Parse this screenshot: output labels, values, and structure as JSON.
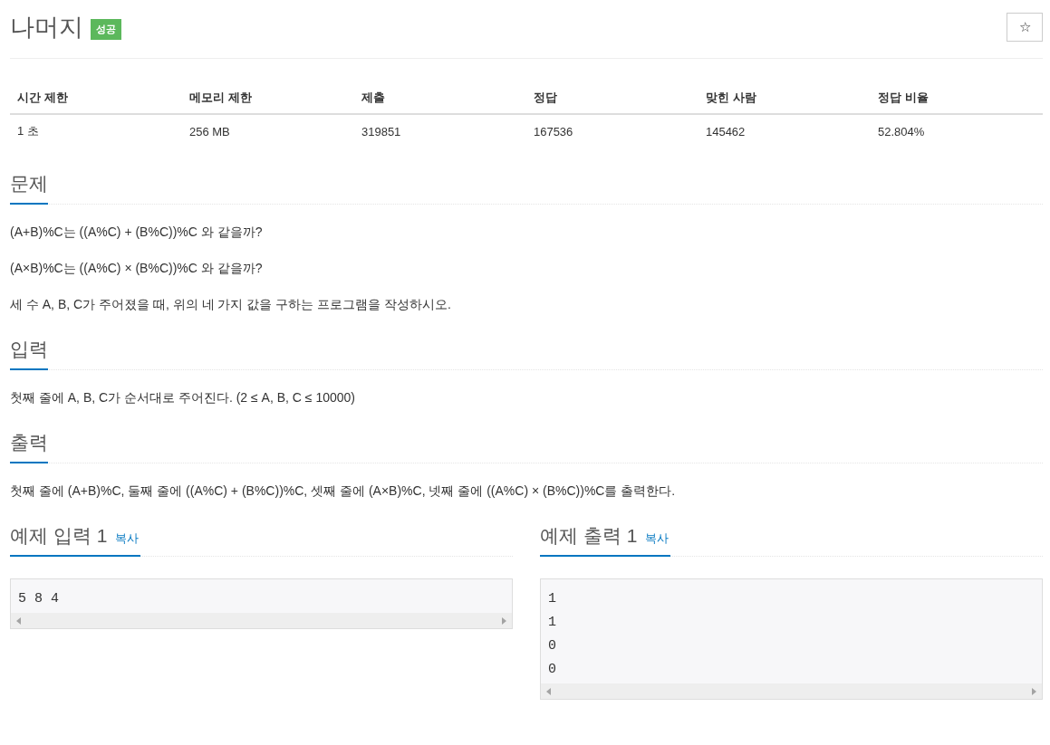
{
  "title": "나머지",
  "badge": "성공",
  "star_button": "☆",
  "info_table": {
    "columns": [
      "시간 제한",
      "메모리 제한",
      "제출",
      "정답",
      "맞힌 사람",
      "정답 비율"
    ],
    "rows": [
      [
        "1 초",
        "256 MB",
        "319851",
        "167536",
        "145462",
        "52.804%"
      ]
    ]
  },
  "sections": [
    {
      "heading": "문제",
      "paragraphs": [
        "(A+B)%C는 ((A%C) + (B%C))%C 와 같을까?",
        "(A×B)%C는 ((A%C) × (B%C))%C 와 같을까?",
        "세 수 A, B, C가 주어졌을 때, 위의 네 가지 값을 구하는 프로그램을 작성하시오."
      ]
    },
    {
      "heading": "입력",
      "paragraphs": [
        "첫째 줄에 A, B, C가 순서대로 주어진다. (2 ≤ A, B, C ≤ 10000)"
      ]
    },
    {
      "heading": "출력",
      "paragraphs": [
        "첫째 줄에 (A+B)%C, 둘째 줄에 ((A%C) + (B%C))%C, 셋째 줄에 (A×B)%C, 넷째 줄에 ((A%C) × (B%C))%C를 출력한다."
      ]
    }
  ],
  "samples": [
    {
      "heading": "예제 입력 1",
      "copy_link": "복사",
      "lines": [
        "5 8 4"
      ]
    },
    {
      "heading": "예제 출력 1",
      "copy_link": "복사",
      "lines": [
        "1",
        "1",
        "0",
        "0"
      ]
    }
  ]
}
